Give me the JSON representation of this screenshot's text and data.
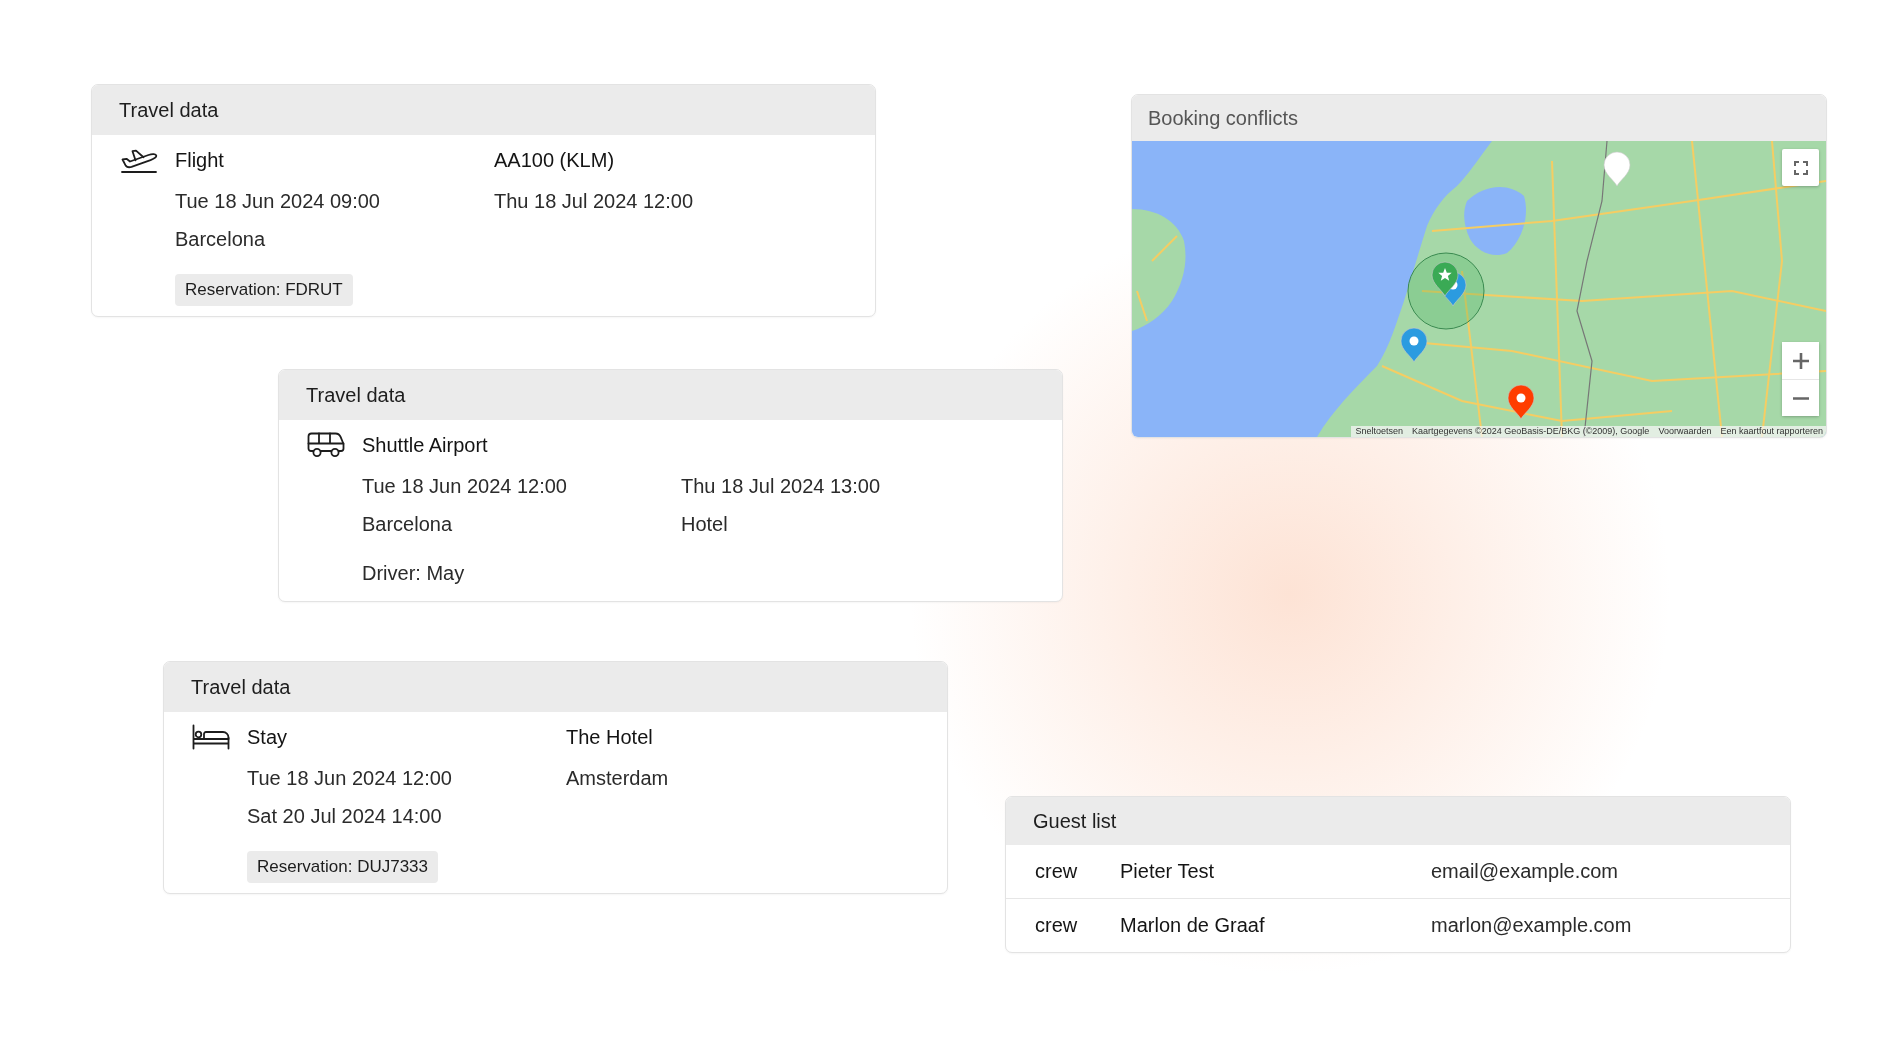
{
  "cards": [
    {
      "header": "Travel data",
      "kind": "flight",
      "title": "Flight",
      "title_right": "AA100 (KLM)",
      "rows": [
        [
          "Tue 18 Jun 2024 09:00",
          "Thu 18 Jul 2024 12:00"
        ],
        [
          "Barcelona"
        ]
      ],
      "reservation": "Reservation: FDRUT"
    },
    {
      "header": "Travel data",
      "kind": "shuttle",
      "title": "Shuttle Airport",
      "rows": [
        [
          "Tue 18 Jun 2024 12:00",
          "Thu 18 Jul 2024 13:00"
        ],
        [
          "Barcelona",
          "Hotel"
        ]
      ],
      "note": "Driver: May"
    },
    {
      "header": "Travel data",
      "kind": "stay",
      "title": "Stay",
      "title_right": "The Hotel",
      "rows": [
        [
          "Tue 18 Jun 2024 12:00",
          "Amsterdam"
        ],
        [
          "Sat 20 Jul 2024 14:00"
        ]
      ],
      "reservation": "Reservation: DUJ7333"
    }
  ],
  "booking_conflicts": {
    "title": "Booking conflicts",
    "map": {
      "markers": [
        {
          "kind": "plain",
          "color": "#ffffff"
        },
        {
          "kind": "dot",
          "color": "#2b9be0"
        },
        {
          "kind": "star",
          "color": "#3aaa55"
        },
        {
          "kind": "dot",
          "color": "#2b9be0"
        },
        {
          "kind": "dot",
          "color": "#ff3d00"
        }
      ],
      "attribution": [
        "Sneltoetsen",
        "Kaartgegevens ©2024 GeoBasis-DE/BKG (©2009), Google",
        "Voorwaarden",
        "Een kaartfout rapporteren"
      ]
    }
  },
  "guest_list": {
    "title": "Guest list",
    "rows": [
      {
        "role": "crew",
        "name": "Pieter Test",
        "email": "email@example.com"
      },
      {
        "role": "crew",
        "name": "Marlon de Graaf",
        "email": "marlon@example.com"
      }
    ]
  }
}
